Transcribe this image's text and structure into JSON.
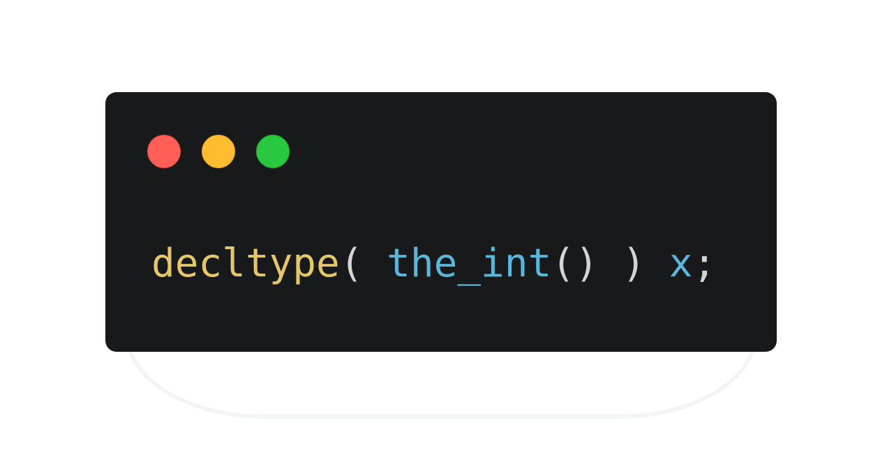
{
  "window": {
    "controls": [
      {
        "name": "close",
        "color": "#ff5f57"
      },
      {
        "name": "minimize",
        "color": "#febc2e"
      },
      {
        "name": "maximize",
        "color": "#28c840"
      }
    ]
  },
  "code": {
    "tokens": [
      {
        "text": "decltype",
        "kind": "type"
      },
      {
        "text": "( ",
        "kind": "punc"
      },
      {
        "text": "the_int",
        "kind": "fn"
      },
      {
        "text": "() ) ",
        "kind": "punc"
      },
      {
        "text": "x",
        "kind": "var"
      },
      {
        "text": ";",
        "kind": "punc"
      }
    ]
  },
  "colors": {
    "background": "#18191b",
    "keyword": "#e5c76b",
    "identifier": "#5ab7da",
    "punctuation": "#d4d4d4"
  }
}
